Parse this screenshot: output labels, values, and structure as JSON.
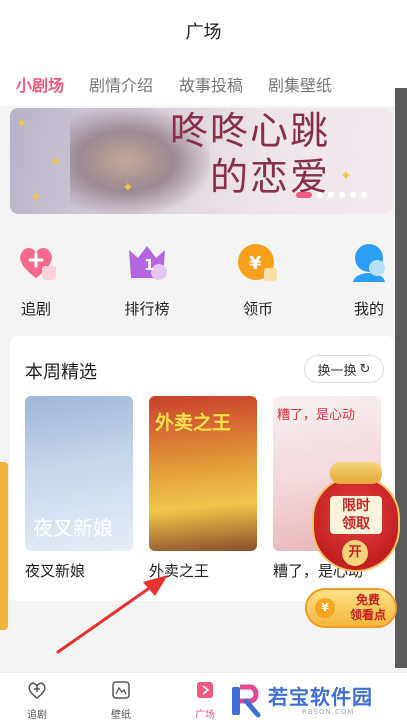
{
  "header": {
    "title": "广场"
  },
  "tabs": [
    {
      "label": "小剧场",
      "active": true
    },
    {
      "label": "剧情介绍",
      "active": false
    },
    {
      "label": "故事投稿",
      "active": false
    },
    {
      "label": "剧集壁纸",
      "active": false
    }
  ],
  "banner": {
    "text_line1": "咚咚心跳",
    "text_line2": "的恋爱",
    "page_count": 6,
    "current_page": 1
  },
  "quick_actions": [
    {
      "label": "追剧",
      "icon": "heart-plus-icon"
    },
    {
      "label": "排行榜",
      "icon": "crown-rank-icon"
    },
    {
      "label": "领币",
      "icon": "coin-yen-icon"
    },
    {
      "label": "我的",
      "icon": "user-icon"
    }
  ],
  "weekly": {
    "title": "本周精选",
    "refresh_label": "换一换",
    "items": [
      {
        "title": "夜叉新娘",
        "poster_text": "夜叉新娘"
      },
      {
        "title": "外卖之王",
        "poster_text": "外卖之王"
      },
      {
        "title": "糟了，是心动",
        "poster_text": "糟了，是心动"
      }
    ]
  },
  "promo": {
    "line1": "限时",
    "line2": "领取",
    "open": "开"
  },
  "free_button": {
    "line1": "免费",
    "line2": "领看点",
    "coin": "¥"
  },
  "bottom_nav": [
    {
      "label": "追剧",
      "icon": "heart-plus-icon"
    },
    {
      "label": "壁纸",
      "icon": "wallpaper-icon"
    },
    {
      "label": "广场",
      "icon": "square-icon"
    }
  ],
  "watermark": {
    "name": "若宝软件园",
    "url": "RBSON.COM"
  },
  "colors": {
    "accent": "#f05a7e",
    "arrow": "#e8322e"
  }
}
